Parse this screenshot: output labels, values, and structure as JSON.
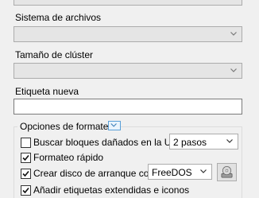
{
  "filesystem": {
    "label": "Sistema de archivos",
    "value": ""
  },
  "cluster": {
    "label": "Tamaño de clúster",
    "value": ""
  },
  "volume_label": {
    "label": "Etiqueta nueva",
    "value": ""
  },
  "format_options": {
    "title": "Opciones de formateo",
    "bad_blocks": {
      "label": "Buscar bloques dañados en la USB:",
      "checked": false,
      "passes_value": "2 pasos"
    },
    "quick_format": {
      "label": "Formateo rápido",
      "checked": true
    },
    "bootable": {
      "label": "Crear disco de arranque con:",
      "checked": true,
      "source_value": "FreeDOS"
    },
    "extended_label": {
      "label": "Añadir etiquetas extendidas e iconos",
      "checked": true
    }
  },
  "icons": {
    "dropdown": "chevron-down-icon",
    "toggle": "expand-toggle-icon",
    "disk": "disk-image-icon"
  }
}
